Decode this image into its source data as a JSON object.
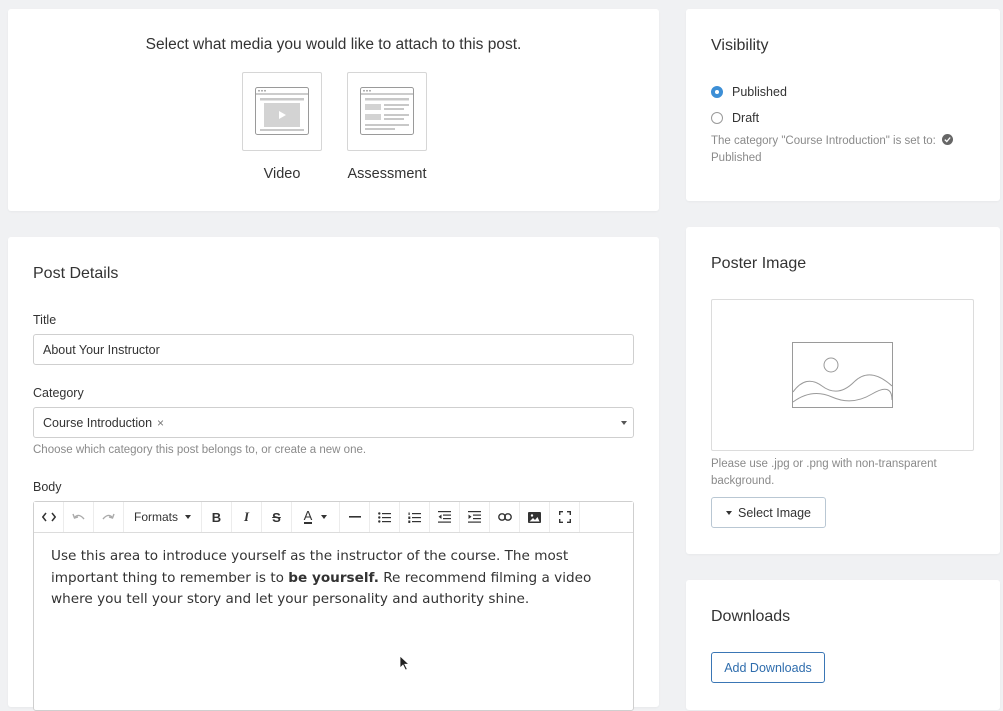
{
  "media": {
    "prompt": "Select what media you would like to attach to this post.",
    "options": [
      {
        "label": "Video",
        "icon": "video-template-icon"
      },
      {
        "label": "Assessment",
        "icon": "assessment-template-icon"
      }
    ]
  },
  "post_details": {
    "title": "Post Details",
    "title_label": "Title",
    "title_value": "About Your Instructor",
    "category_label": "Category",
    "category_value": "Course Introduction",
    "category_remove": "×",
    "category_help": "Choose which category this post belongs to, or create a new one.",
    "body_label": "Body",
    "toolbar": {
      "formats_label": "Formats",
      "buttons": [
        "code-icon",
        "undo-icon",
        "redo-icon",
        "bold-icon",
        "italic-icon",
        "strikethrough-icon",
        "text-color-icon",
        "horizontal-rule-icon",
        "bullet-list-icon",
        "numbered-list-icon",
        "outdent-icon",
        "indent-icon",
        "link-icon",
        "image-icon",
        "fullscreen-icon"
      ]
    },
    "body_text_before": "Use this area to introduce yourself as the instructor of the course. The most important thing to remember is to ",
    "body_text_bold": "be yourself.",
    "body_text_after": " Re recommend filming a video where you tell your story and let your personality and authority shine."
  },
  "visibility": {
    "title": "Visibility",
    "options": [
      {
        "label": "Published",
        "checked": true
      },
      {
        "label": "Draft",
        "checked": false
      }
    ],
    "note": "The category \"Course Introduction\" is set to:",
    "note_status": "Published"
  },
  "poster": {
    "title": "Poster Image",
    "help": "Please use .jpg or .png with non-transparent background.",
    "button_label": "Select Image"
  },
  "downloads": {
    "title": "Downloads",
    "button_label": "Add Downloads"
  },
  "colors": {
    "accent": "#3d8fd6",
    "page_bg": "#f0f1f3",
    "link_blue": "#2f6dad"
  }
}
